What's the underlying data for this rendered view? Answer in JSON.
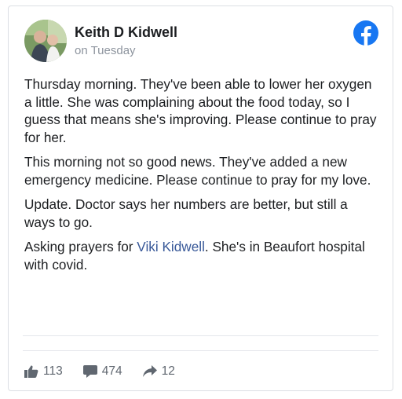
{
  "post": {
    "author": "Keith D Kidwell",
    "timestamp": "on Tuesday",
    "paragraphs": [
      "Thursday morning. They've been able to lower her oxygen a little. She was complaining about the food today, so I guess that means she's improving. Please continue to pray for her.",
      "This morning not so good news. They've added a new emergency medicine. Please continue to pray for my love.",
      "Update. Doctor says her numbers are better, but still a ways to go."
    ],
    "last_paragraph": {
      "before": "Asking prayers for ",
      "mention": "Viki Kidwell",
      "after": ". She's in Beaufort hospital with covid."
    },
    "stats": {
      "likes": "113",
      "comments": "474",
      "shares": "12"
    }
  },
  "icons": {
    "brand": "facebook-logo-icon",
    "like": "thumbs-up-icon",
    "comment": "comment-bubble-icon",
    "share": "share-arrow-icon"
  },
  "colors": {
    "facebook_blue": "#1877f2",
    "mention_blue": "#385898",
    "secondary_text": "#606770"
  }
}
